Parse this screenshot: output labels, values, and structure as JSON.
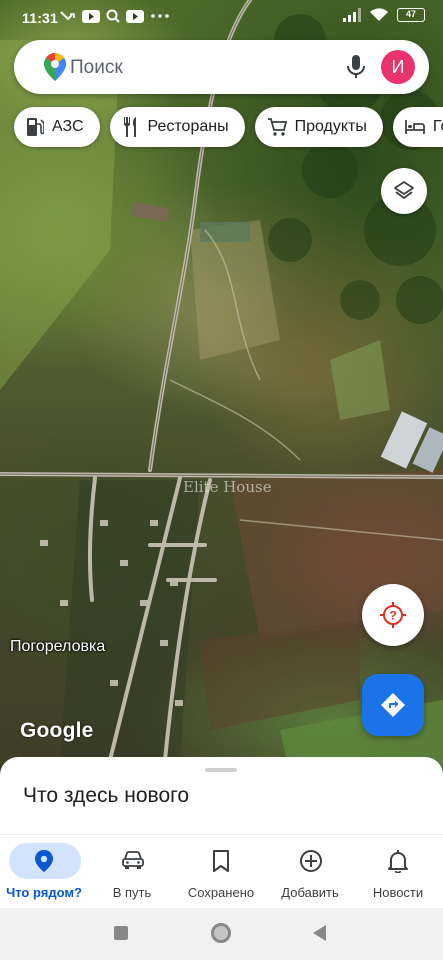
{
  "status_bar": {
    "time": "11:31",
    "battery": "47"
  },
  "search": {
    "placeholder": "Поиск",
    "avatar_letter": "И",
    "avatar_color": "#e8336c"
  },
  "chips": [
    {
      "label": "АЗС",
      "icon": "gas-station-icon"
    },
    {
      "label": "Рестораны",
      "icon": "restaurant-icon"
    },
    {
      "label": "Продукты",
      "icon": "shopping-cart-icon"
    },
    {
      "label": "Го",
      "icon": "hotel-bed-icon"
    }
  ],
  "map": {
    "place_label": "Погореловка",
    "logo": "Google",
    "watermark": "Elite House"
  },
  "sheet": {
    "title": "Что здесь нового"
  },
  "bottom_nav": {
    "items": [
      {
        "label": "Что рядом?",
        "icon": "location-pin-icon",
        "active": true
      },
      {
        "label": "В путь",
        "icon": "car-icon",
        "active": false
      },
      {
        "label": "Сохранено",
        "icon": "bookmark-icon",
        "active": false
      },
      {
        "label": "Добавить",
        "icon": "add-circle-icon",
        "active": false
      },
      {
        "label": "Новости",
        "icon": "bell-icon",
        "active": false
      }
    ]
  },
  "colors": {
    "accent": "#1a73e8",
    "active_pill": "#d3e3fd",
    "locate_red": "#d93025"
  }
}
